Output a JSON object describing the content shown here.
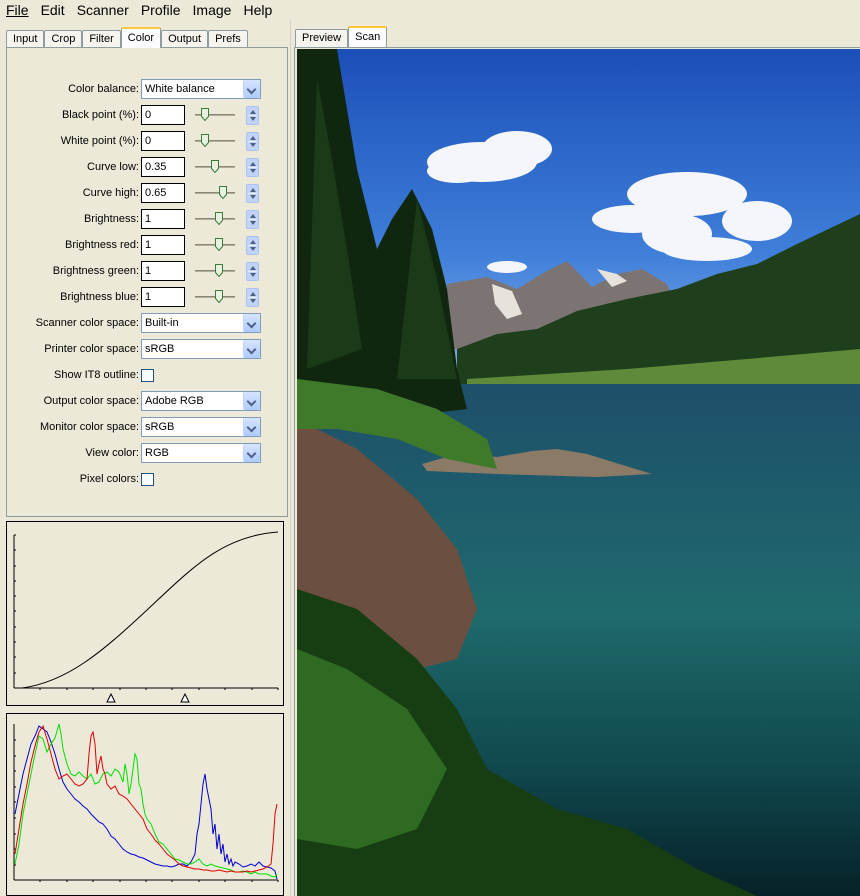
{
  "menu": {
    "items": [
      {
        "label": "File"
      },
      {
        "label": "Edit"
      },
      {
        "label": "Scanner"
      },
      {
        "label": "Profile"
      },
      {
        "label": "Image"
      },
      {
        "label": "Help"
      }
    ]
  },
  "left_tabs": [
    "Input",
    "Crop",
    "Filter",
    "Color",
    "Output",
    "Prefs"
  ],
  "left_active_tab": "Color",
  "right_tabs": [
    "Preview",
    "Scan"
  ],
  "right_active_tab": "Scan",
  "color": {
    "color_balance": {
      "label": "Color balance:",
      "value": "White balance"
    },
    "black_point": {
      "label": "Black point (%):",
      "value": "0",
      "slider_fraction": 0.0
    },
    "white_point": {
      "label": "White point (%):",
      "value": "0",
      "slider_fraction": 0.0
    },
    "curve_low": {
      "label": "Curve low:",
      "value": "0.35",
      "slider_fraction": 0.35
    },
    "curve_high": {
      "label": "Curve high:",
      "value": "0.65",
      "slider_fraction": 0.65
    },
    "brightness": {
      "label": "Brightness:",
      "value": "1",
      "slider_fraction": 0.5
    },
    "brightness_red": {
      "label": "Brightness red:",
      "value": "1",
      "slider_fraction": 0.5
    },
    "brightness_green": {
      "label": "Brightness green:",
      "value": "1",
      "slider_fraction": 0.5
    },
    "brightness_blue": {
      "label": "Brightness blue:",
      "value": "1",
      "slider_fraction": 0.5
    },
    "scanner_color_space": {
      "label": "Scanner color space:",
      "value": "Built-in"
    },
    "printer_color_space": {
      "label": "Printer color space:",
      "value": "sRGB"
    },
    "show_it8": {
      "label": "Show IT8 outline:",
      "checked": false
    },
    "output_color_space": {
      "label": "Output color space:",
      "value": "Adobe RGB"
    },
    "monitor_color_space": {
      "label": "Monitor color space:",
      "value": "sRGB"
    },
    "view_color": {
      "label": "View color:",
      "value": "RGB"
    },
    "pixel_colors": {
      "label": "Pixel colors:",
      "checked": false
    }
  },
  "colors": {
    "tab_accent": "#ffc83c",
    "hist_red": "#e00000",
    "hist_green": "#00e000",
    "hist_blue": "#0000d0"
  },
  "icons": [
    "slider-thumb-icon",
    "spin-up-icon",
    "spin-down-icon",
    "dropdown-arrow-icon",
    "curve-low-marker-icon",
    "curve-high-marker-icon"
  ]
}
